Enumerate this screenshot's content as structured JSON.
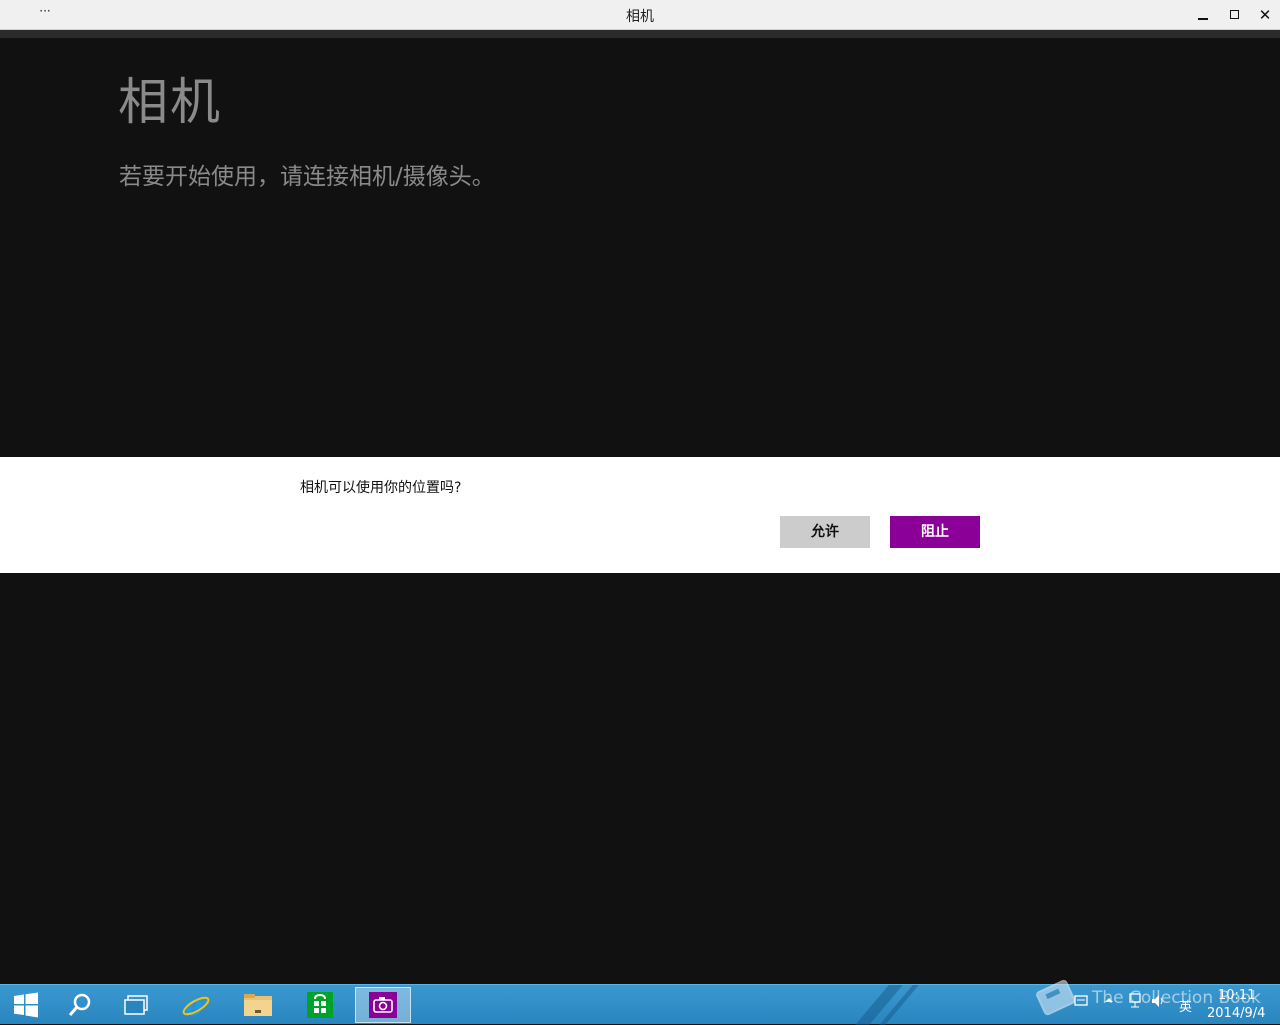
{
  "window": {
    "title": "相机",
    "menu_glyph": "···",
    "minimize_glyph": "",
    "maximize_glyph": "",
    "close_glyph": "✕"
  },
  "app": {
    "heading": "相机",
    "message": "若要开始使用，请连接相机/摄像头。"
  },
  "dialog": {
    "question": "相机可以使用你的位置吗?",
    "allow_label": "允许",
    "block_label": "阻止",
    "block_color": "#8b0096"
  },
  "taskbar": {
    "items": [
      {
        "name": "start",
        "icon": "windows-logo-icon"
      },
      {
        "name": "search",
        "icon": "search-icon"
      },
      {
        "name": "task-view",
        "icon": "task-view-icon"
      },
      {
        "name": "internet-explorer",
        "icon": "ie-icon"
      },
      {
        "name": "file-explorer",
        "icon": "folder-icon"
      },
      {
        "name": "store",
        "icon": "store-icon"
      },
      {
        "name": "camera",
        "icon": "camera-icon",
        "active": true
      }
    ],
    "tray": {
      "ime": "英",
      "time": "10:11",
      "date": "2014/9/4"
    },
    "watermark": "The Collection Book"
  }
}
